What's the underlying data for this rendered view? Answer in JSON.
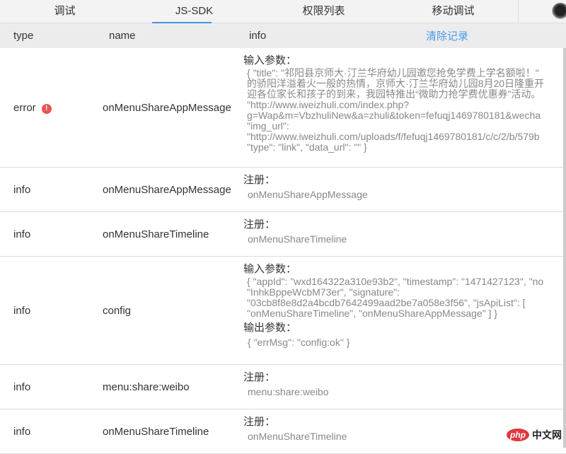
{
  "tabs": [
    {
      "label": "调试"
    },
    {
      "label": "JS-SDK"
    },
    {
      "label": "权限列表"
    },
    {
      "label": "移动调试"
    }
  ],
  "header": {
    "type": "type",
    "name": "name",
    "info": "info",
    "clear": "清除记录"
  },
  "rows": [
    {
      "type": "error",
      "name": "onMenuShareAppMessage",
      "blocks": [
        {
          "label": "输入参数：",
          "lines": [
            "{ \"title\": \"祁阳县京师大·汀兰华府幼儿园邀您抢免学费上学名额啦！\"",
            "的骄阳洋溢着火一般的热情，京师大·汀兰华府幼儿园8月20日隆重开",
            "迎各位家长和孩子的到来，我园特推出“微助力抢学费优惠券”活动。",
            "\"http://www.iweizhuli.com/index.php?",
            "g=Wap&m=VbzhuliNew&a=zhuli&token=fefuqj1469780181&wecha",
            "\"img_url\":",
            "\"http://www.iweizhuli.com/uploads/f/fefuqj1469780181/c/c/2/b/579b",
            "\"type\": \"link\", \"data_url\": \"\" }"
          ]
        }
      ]
    },
    {
      "type": "info",
      "name": "onMenuShareAppMessage",
      "blocks": [
        {
          "label": "注册：",
          "lines": [
            "onMenuShareAppMessage"
          ]
        }
      ]
    },
    {
      "type": "info",
      "name": "onMenuShareTimeline",
      "blocks": [
        {
          "label": "注册：",
          "lines": [
            "onMenuShareTimeline"
          ]
        }
      ]
    },
    {
      "type": "info",
      "name": "config",
      "blocks": [
        {
          "label": "输入参数：",
          "lines": [
            "{ \"appId\": \"wxd164322a310e93b2\", \"timestamp\": \"1471427123\", \"no",
            "\"InhkBppeWcbM73er\", \"signature\":",
            "\"03cb8f8e8d2a4bcdb7642499aad2be7a058e3f56\", \"jsApiList\": [",
            "\"onMenuShareTimeline\", \"onMenuShareAppMessage\" ] }"
          ]
        },
        {
          "label": "输出参数：",
          "lines": [
            "{ \"errMsg\": \"config:ok\" }"
          ]
        }
      ]
    },
    {
      "type": "info",
      "name": "menu:share:weibo",
      "blocks": [
        {
          "label": "注册：",
          "lines": [
            "menu:share:weibo"
          ]
        }
      ]
    },
    {
      "type": "info",
      "name": "onMenuShareTimeline",
      "blocks": [
        {
          "label": "注册：",
          "lines": [
            "onMenuShareTimeline"
          ]
        }
      ]
    }
  ],
  "watermark": {
    "php": "php",
    "cn": "中文网"
  },
  "error_icon": "!"
}
